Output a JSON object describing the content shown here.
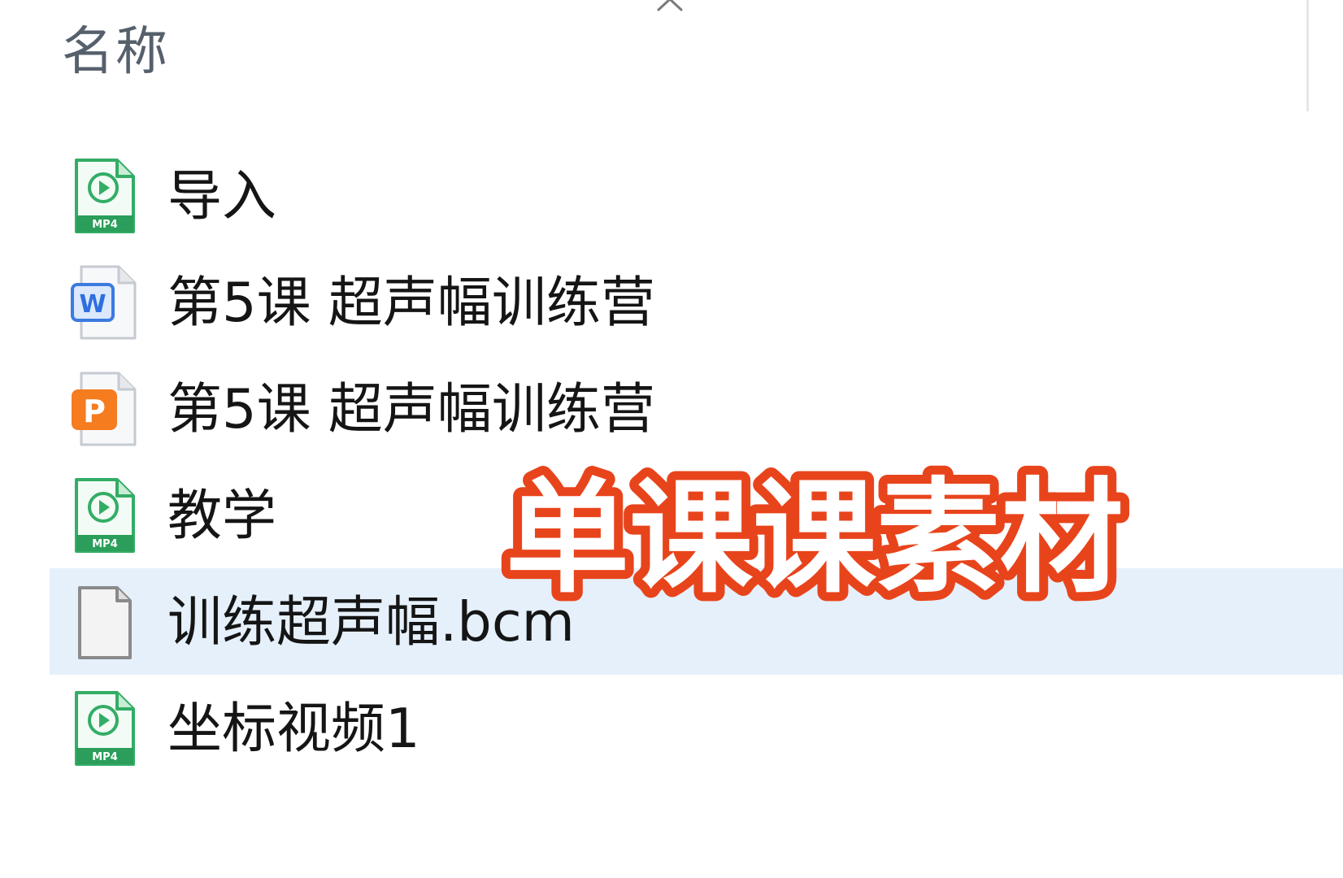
{
  "header": {
    "name_column": "名称",
    "sort_icon": "chevron-up-icon"
  },
  "files": [
    {
      "name": "导入",
      "icon": "mp4-video-file-icon",
      "icon_label": "MP4",
      "selected": false
    },
    {
      "name": "第5课 超声幅训练营",
      "icon": "word-document-icon",
      "icon_label": "W",
      "selected": false
    },
    {
      "name": "第5课 超声幅训练营",
      "icon": "powerpoint-file-icon",
      "icon_label": "P",
      "selected": false
    },
    {
      "name": "教学",
      "icon": "mp4-video-file-icon",
      "icon_label": "MP4",
      "selected": false
    },
    {
      "name": "训练超声幅.bcm",
      "icon": "blank-file-icon",
      "selected": true
    },
    {
      "name": "坐标视频1",
      "icon": "mp4-video-file-icon",
      "icon_label": "MP4",
      "selected": false
    }
  ],
  "overlay": {
    "caption": "单课课素材"
  },
  "colors": {
    "selection_background": "#e5f0fb",
    "video_icon_green": "#33ad66",
    "word_icon_blue": "#3c7be0",
    "ppt_icon_orange": "#f57c1f",
    "caption_fill": "#ffffff",
    "caption_outline": "#e8441c"
  }
}
